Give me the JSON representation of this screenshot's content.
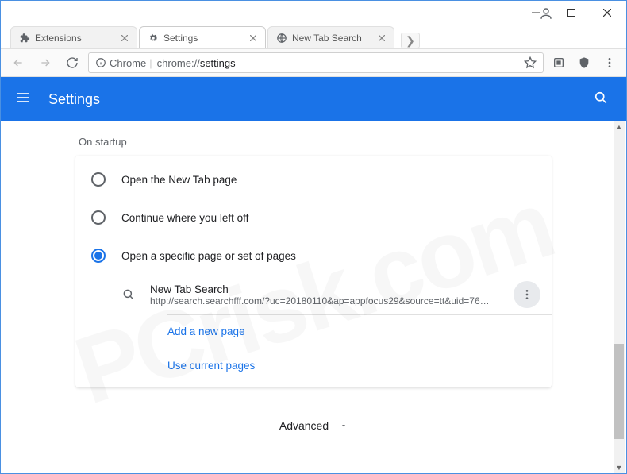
{
  "window": {
    "tabs": [
      {
        "title": "Extensions",
        "active": false
      },
      {
        "title": "Settings",
        "active": true
      },
      {
        "title": "New Tab Search",
        "active": false
      }
    ]
  },
  "addressbar": {
    "secure_label": "Chrome",
    "url_prefix": "chrome://",
    "url_path": "settings"
  },
  "header": {
    "title": "Settings"
  },
  "startup": {
    "section_label": "On startup",
    "options": {
      "new_tab": "Open the New Tab page",
      "continue": "Continue where you left off",
      "specific": "Open a specific page or set of pages"
    },
    "selected": "specific",
    "pages": [
      {
        "title": "New Tab Search",
        "url": "http://search.searchfff.com/?uc=20180110&ap=appfocus29&source=tt&uid=76f661f…"
      }
    ],
    "add_page": "Add a new page",
    "use_current": "Use current pages"
  },
  "advanced_label": "Advanced",
  "watermark": "PCrisk.com"
}
